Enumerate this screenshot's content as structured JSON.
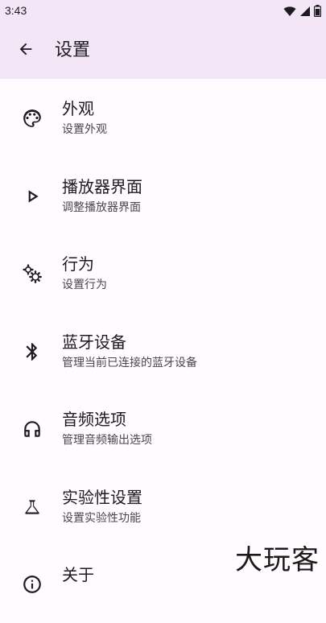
{
  "status_bar": {
    "time": "3:43",
    "icons": [
      "wifi-icon",
      "cell-signal-icon",
      "battery-icon"
    ]
  },
  "app_bar": {
    "back_icon": "arrow-back-icon",
    "title": "设置"
  },
  "settings": [
    {
      "id": "appearance",
      "icon": "palette-icon",
      "title": "外观",
      "subtitle": "设置外观"
    },
    {
      "id": "player",
      "icon": "play-outline-icon",
      "title": "播放器界面",
      "subtitle": "调整播放器界面"
    },
    {
      "id": "behavior",
      "icon": "gears-icon",
      "title": "行为",
      "subtitle": "设置行为"
    },
    {
      "id": "bluetooth",
      "icon": "bluetooth-icon",
      "title": "蓝牙设备",
      "subtitle": "管理当前已连接的蓝牙设备"
    },
    {
      "id": "audio",
      "icon": "headphones-icon",
      "title": "音频选项",
      "subtitle": "管理音频输出选项"
    },
    {
      "id": "experimental",
      "icon": "flask-icon",
      "title": "实验性设置",
      "subtitle": "设置实验性功能"
    },
    {
      "id": "about",
      "icon": "info-icon",
      "title": "关于",
      "subtitle": ""
    }
  ],
  "watermark": "大玩客",
  "colors": {
    "app_bar_bg": "#F3E6F7",
    "background": "#FFFBFE",
    "title_text": "#1C1B1F",
    "subtitle_text": "#49454F"
  }
}
